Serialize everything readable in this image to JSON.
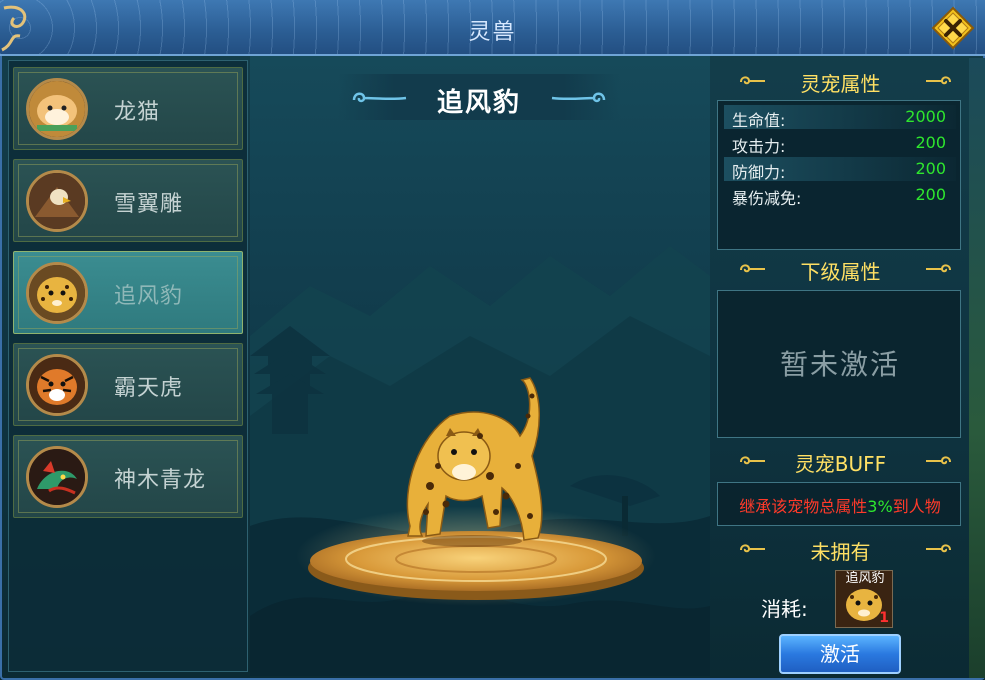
{
  "window": {
    "title": "灵兽",
    "close_icon": "close-icon"
  },
  "pets": [
    {
      "name": "龙猫",
      "icon": "hamster-avatar-icon",
      "selected": false
    },
    {
      "name": "雪翼雕",
      "icon": "eagle-avatar-icon",
      "selected": false
    },
    {
      "name": "追风豹",
      "icon": "leopard-avatar-icon",
      "selected": true
    },
    {
      "name": "霸天虎",
      "icon": "tiger-avatar-icon",
      "selected": false
    },
    {
      "name": "神木青龙",
      "icon": "dragon-avatar-icon",
      "selected": false
    }
  ],
  "stage": {
    "pet_name": "追风豹"
  },
  "attributes": {
    "title": "灵宠属性",
    "rows": [
      {
        "label": "生命值:",
        "value": "2000"
      },
      {
        "label": "攻击力:",
        "value": "200"
      },
      {
        "label": "防御力:",
        "value": "200"
      },
      {
        "label": "暴伤减免:",
        "value": "200"
      }
    ]
  },
  "next_level": {
    "title": "下级属性",
    "status": "暂未激活"
  },
  "buff": {
    "title": "灵宠BUFF",
    "text_before": "继承该宠物总属性",
    "percent": "3%",
    "text_after": "到人物"
  },
  "ownership": {
    "title": "未拥有",
    "cost_label": "消耗:",
    "cost_item_name": "追风豹",
    "cost_item_count": "1",
    "activate_label": "激活"
  },
  "colors": {
    "accent_gold": "#ffe064",
    "value_green": "#2ee62e",
    "buff_red": "#ff3a2a",
    "button_blue": "#2a79e0"
  }
}
